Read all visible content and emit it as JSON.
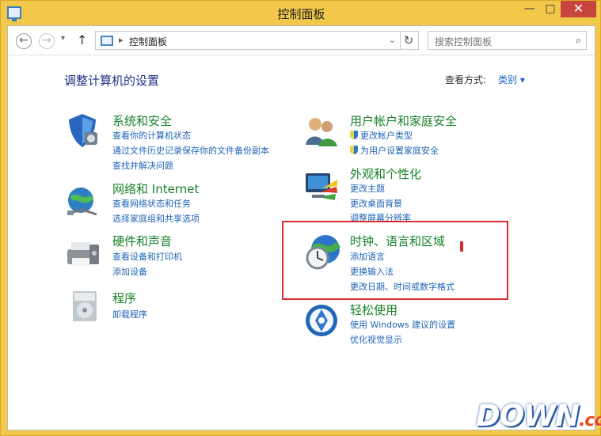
{
  "window": {
    "title": "控制面板",
    "buttons": {
      "minimize": "—",
      "maximize": "□",
      "close": "✕"
    }
  },
  "nav": {
    "back": "←",
    "forward": "→",
    "recent": "▾",
    "up": "↑",
    "address_text": "控制面板",
    "address_separator": "▸",
    "address_dropdown": "⌄",
    "refresh": "↻",
    "search_placeholder": "搜索控制面板",
    "search_icon": "⌕"
  },
  "page": {
    "heading": "调整计算机的设置",
    "view_by_label": "查看方式:",
    "view_by_value": "类别 ▾"
  },
  "categories": [
    {
      "title": "系统和安全",
      "links": [
        "查看你的计算机状态",
        "通过文件历史记录保存你的文件备份副本",
        "查找并解决问题"
      ]
    },
    {
      "title": "网络和 Internet",
      "links": [
        "查看网络状态和任务",
        "选择家庭组和共享选项"
      ]
    },
    {
      "title": "硬件和声音",
      "links": [
        "查看设备和打印机",
        "添加设备"
      ]
    },
    {
      "title": "程序",
      "links": [
        "卸载程序"
      ]
    },
    {
      "title": "用户帐户和家庭安全",
      "links": [
        "更改帐户类型",
        "为用户设置家庭安全"
      ]
    },
    {
      "title": "外观和个性化",
      "links": [
        "更改主题",
        "更改桌面背景",
        "调整屏幕分辨率"
      ]
    },
    {
      "title": "时钟、语言和区域",
      "links": [
        "添加语言",
        "更换输入法",
        "更改日期、时间或数字格式"
      ]
    },
    {
      "title": "轻松使用",
      "links": [
        "使用 Windows 建议的设置",
        "优化视觉显示"
      ]
    }
  ],
  "watermark": {
    "main": "DOWN",
    "suffix": ".cc"
  }
}
